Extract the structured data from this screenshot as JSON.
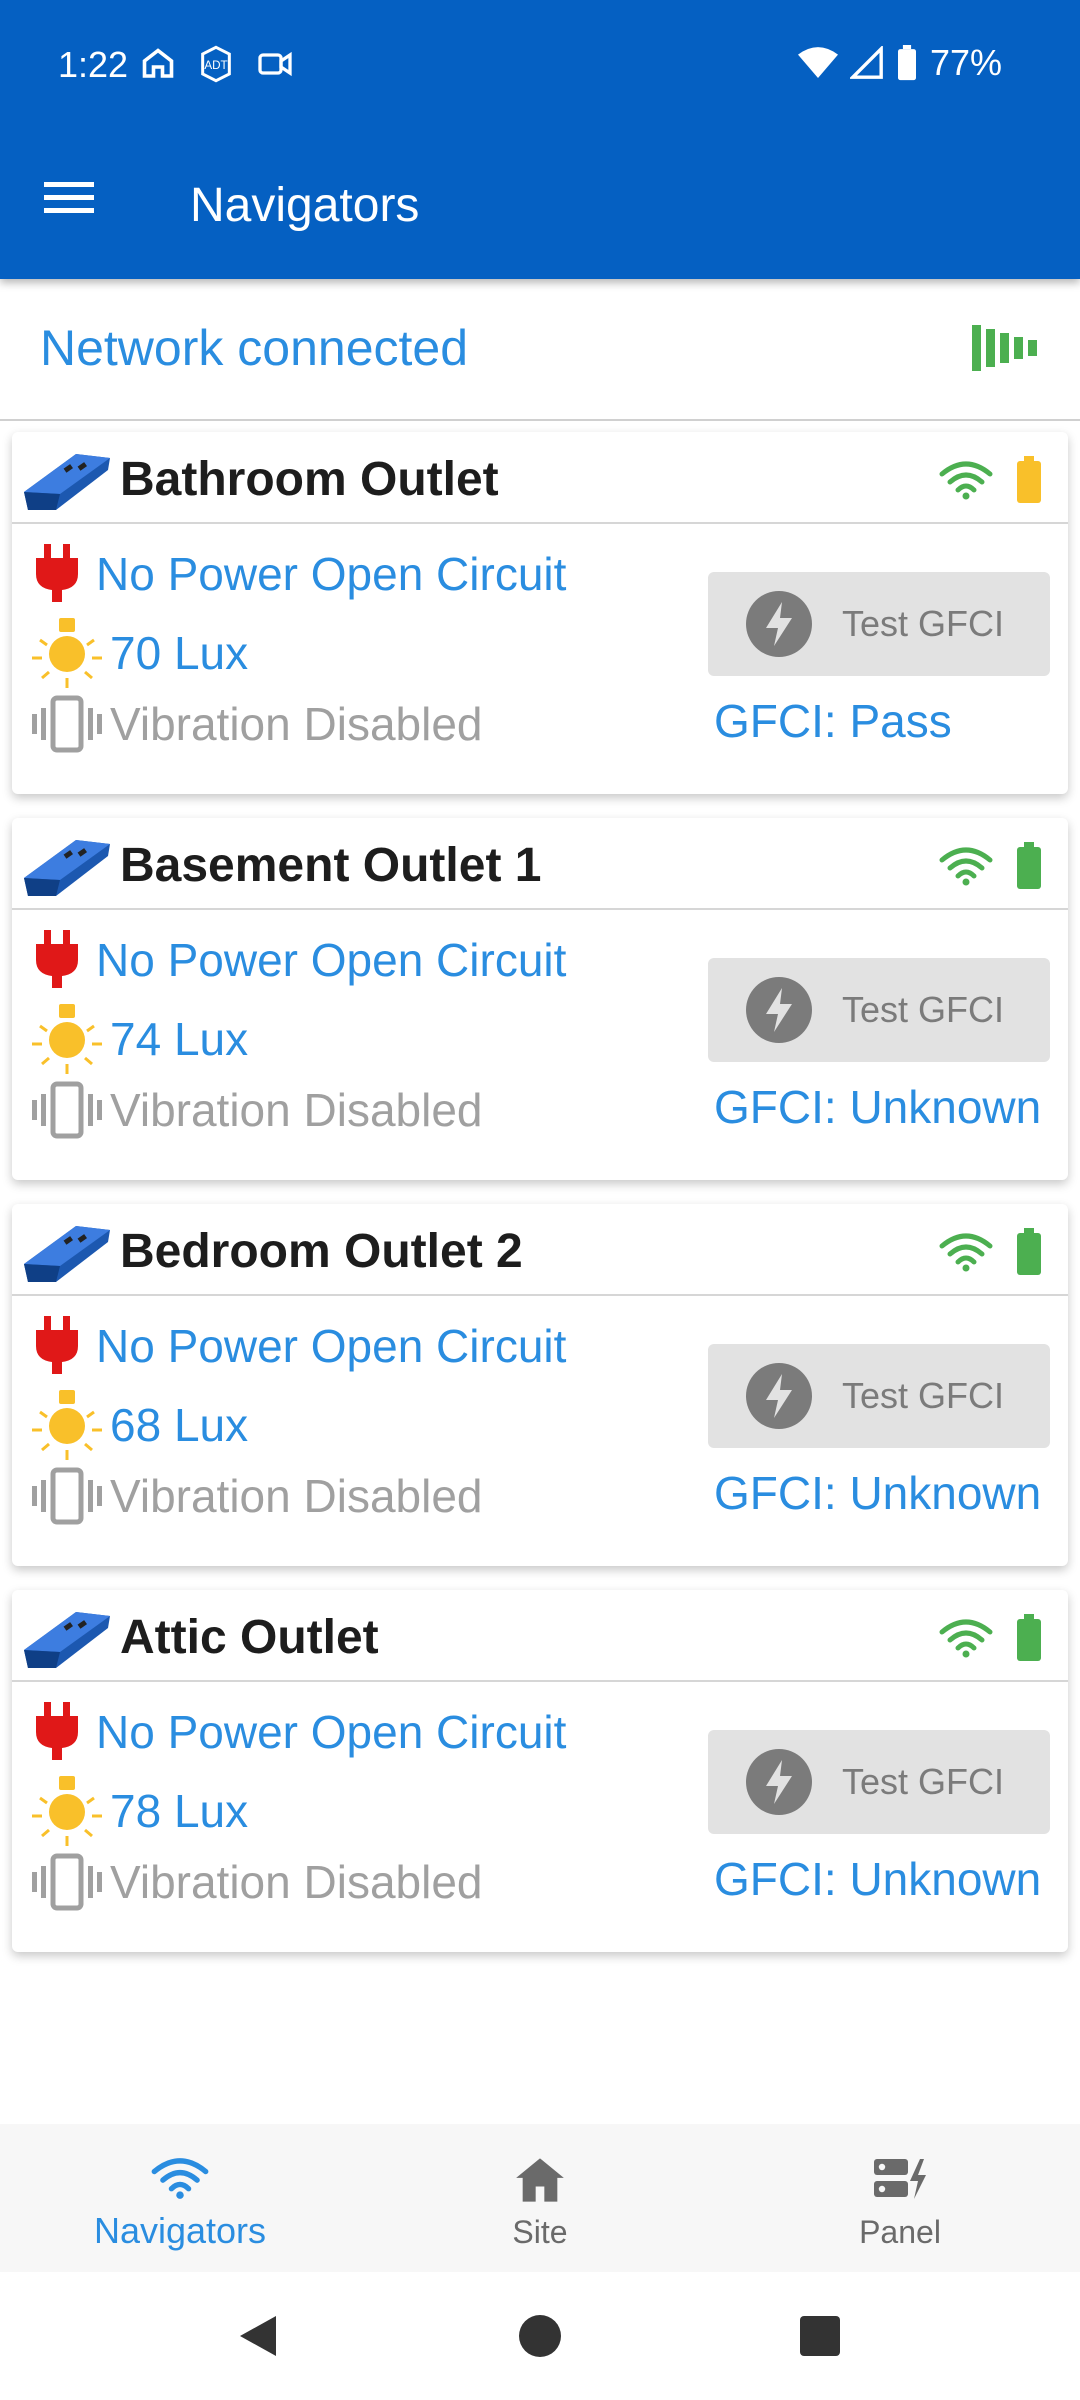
{
  "status_bar": {
    "time": "1:22",
    "battery": "77%"
  },
  "app_bar": {
    "title": "Navigators"
  },
  "network": {
    "status_text": "Network connected"
  },
  "colors": {
    "primary": "#0560c2",
    "accent_blue": "#2a8de0",
    "good_green": "#4caf50",
    "warn_yellow": "#f9c02a",
    "plug_red": "#e01818"
  },
  "devices": [
    {
      "name": "Bathroom Outlet",
      "power": "No Power Open Circuit",
      "lux": "70 Lux",
      "vibration": "Vibration Disabled",
      "test_label": "Test GFCI",
      "gfci": "GFCI: Pass",
      "battery_color": "#f9c02a"
    },
    {
      "name": "Basement Outlet 1",
      "power": "No Power Open Circuit",
      "lux": "74 Lux",
      "vibration": "Vibration Disabled",
      "test_label": "Test GFCI",
      "gfci": "GFCI: Unknown",
      "battery_color": "#4caf50"
    },
    {
      "name": "Bedroom Outlet 2",
      "power": "No Power Open Circuit",
      "lux": "68 Lux",
      "vibration": "Vibration Disabled",
      "test_label": "Test GFCI",
      "gfci": "GFCI: Unknown",
      "battery_color": "#4caf50"
    },
    {
      "name": "Attic Outlet",
      "power": "No Power Open Circuit",
      "lux": "78 Lux",
      "vibration": "Vibration Disabled",
      "test_label": "Test GFCI",
      "gfci": "GFCI: Unknown",
      "battery_color": "#4caf50"
    }
  ],
  "bottom_nav": [
    {
      "label": "Navigators",
      "icon": "wifi-icon",
      "active": true
    },
    {
      "label": "Site",
      "icon": "home-icon",
      "active": false
    },
    {
      "label": "Panel",
      "icon": "panel-icon",
      "active": false
    }
  ]
}
